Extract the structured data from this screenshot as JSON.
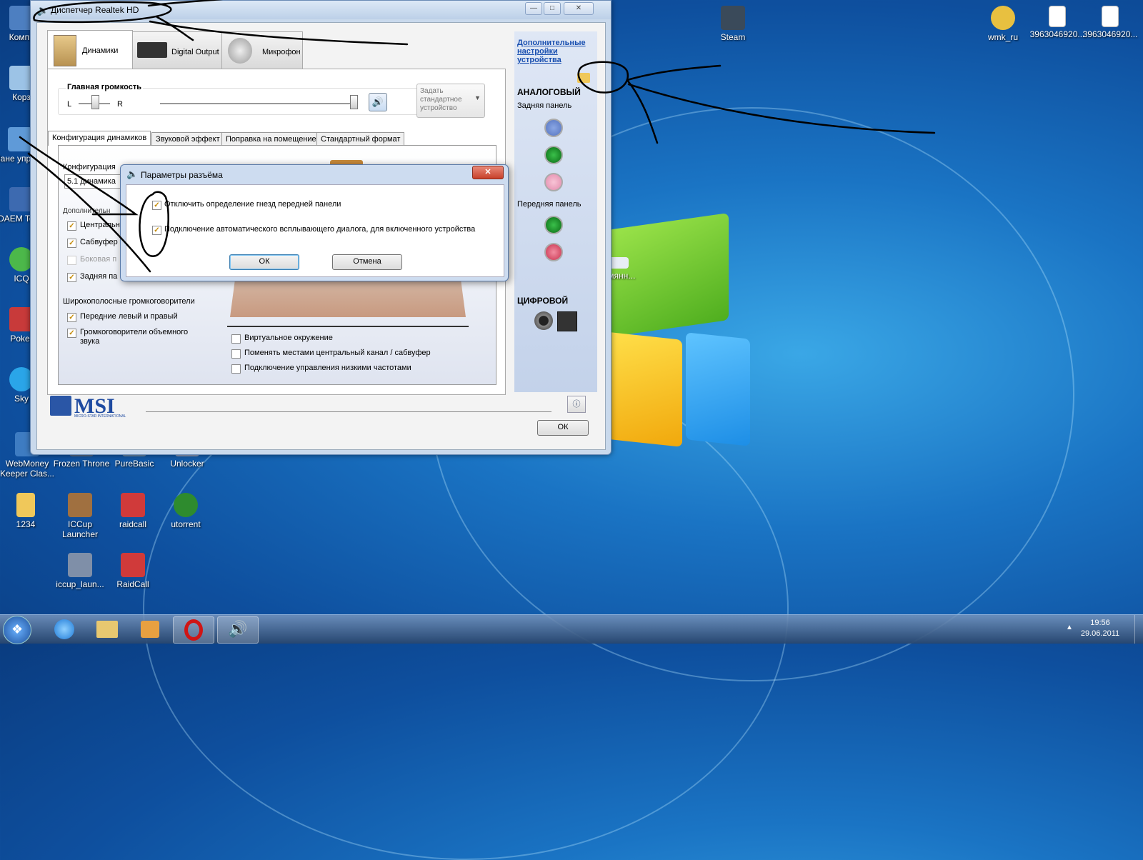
{
  "desktop": {
    "left_icons": [
      {
        "label": "Компь"
      },
      {
        "label": "Корз"
      },
      {
        "label": "Пане управл"
      },
      {
        "label": "DAEM Tools"
      },
      {
        "label": "ICQ"
      },
      {
        "label": "Poker"
      },
      {
        "label": "Sky"
      }
    ],
    "grid_icons": [
      {
        "label": "WebMoney Keeper Clas..."
      },
      {
        "label": "Frozen Throne"
      },
      {
        "label": "PureBasic"
      },
      {
        "label": "Unlocker"
      },
      {
        "label": "1234"
      },
      {
        "label": "ICCup Launcher"
      },
      {
        "label": "raidcall"
      },
      {
        "label": "utorrent"
      },
      {
        "label": "iccup_laun..."
      },
      {
        "label": "RaidCall"
      }
    ],
    "top_icons": [
      {
        "label": "Steam"
      },
      {
        "label": "wmk_ru"
      },
      {
        "label": "3963046920..."
      },
      {
        "label": "3963046920..."
      }
    ],
    "partial_label": "ымянн..."
  },
  "window": {
    "title": "Диспетчер Realtek HD",
    "tabs": [
      {
        "label": "Динамики"
      },
      {
        "label": "Digital Output"
      },
      {
        "label": "Микрофон"
      }
    ],
    "volume": {
      "label": "Главная громкость",
      "left": "L",
      "right": "R"
    },
    "default_device": "Задать стандартное устройство",
    "subtabs": [
      {
        "label": "Конфигурация динамиков"
      },
      {
        "label": "Звуковой эффект"
      },
      {
        "label": "Поправка на помещение"
      },
      {
        "label": "Стандартный формат"
      }
    ],
    "config_label": "Конфигурация",
    "config_value": "5.1 динамика",
    "extra_label": "Дополнительн",
    "extra_items": [
      {
        "label": "Центральн",
        "checked": true
      },
      {
        "label": "Сабвуфер",
        "checked": true
      },
      {
        "label": "Боковая п",
        "checked": false
      },
      {
        "label": "Задняя па",
        "checked": true
      }
    ],
    "wideband": {
      "title": "Широкополосные громкоговорители",
      "items": [
        {
          "label": "Передние левый и правый",
          "checked": true
        },
        {
          "label": "Громкоговорители объемного звука",
          "checked": true
        }
      ]
    },
    "options": [
      {
        "label": "Виртуальное окружение",
        "checked": false
      },
      {
        "label": "Поменять местами центральный канал / сабвуфер",
        "checked": false
      },
      {
        "label": "Подключение управления низкими частотами",
        "checked": false
      }
    ],
    "sidebar": {
      "link": "Дополнительные настройки устройства",
      "analog": "АНАЛОГОВЫЙ",
      "back_panel": "Задняя панель",
      "front_panel": "Передняя панель",
      "digital": "ЦИФРОВОЙ",
      "colors": {
        "blue": "#6f8fd8",
        "green": "#1a9a2a",
        "pink": "#f0a4c0",
        "red": "#e0506a"
      }
    },
    "brand": "MSI",
    "brand_sub": "MICRO-STAR INTERNATIONAL",
    "ok_label": "ОК"
  },
  "dialog": {
    "title": "Параметры разъёма",
    "checks": [
      {
        "label": "Отключить определение гнезд передней панели",
        "checked": true
      },
      {
        "label": "Подключение автоматического всплывающего диалога, для включенного устройства",
        "checked": true
      }
    ],
    "ok": "ОК",
    "cancel": "Отмена"
  },
  "taskbar": {
    "time": "19:56",
    "date": "29.06.2011"
  }
}
